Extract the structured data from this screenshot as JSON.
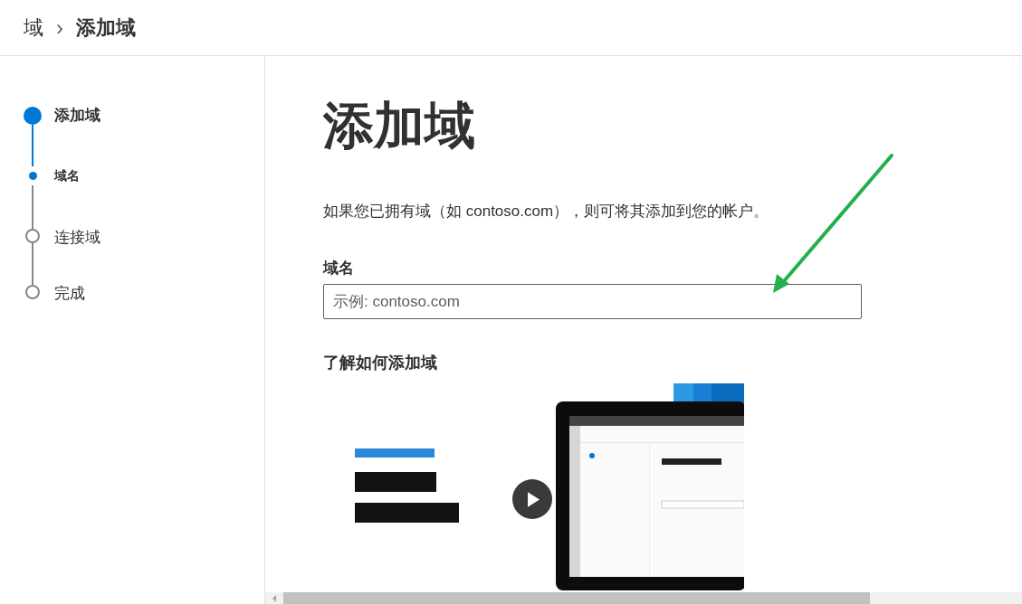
{
  "breadcrumb": {
    "parent": "域",
    "separator": "›",
    "current": "添加域"
  },
  "steps": [
    {
      "kind": "step",
      "label": "添加域",
      "active": true
    },
    {
      "kind": "substep",
      "label": "域名",
      "active": true
    },
    {
      "kind": "step",
      "label": "连接域",
      "active": false
    },
    {
      "kind": "step",
      "label": "完成",
      "active": false
    }
  ],
  "page": {
    "title": "添加域",
    "description": "如果您已拥有域（如 contoso.com），则可将其添加到您的帐户。",
    "field": {
      "label": "域名",
      "placeholder": "示例: contoso.com"
    },
    "video": {
      "heading": "了解如何添加域"
    }
  }
}
